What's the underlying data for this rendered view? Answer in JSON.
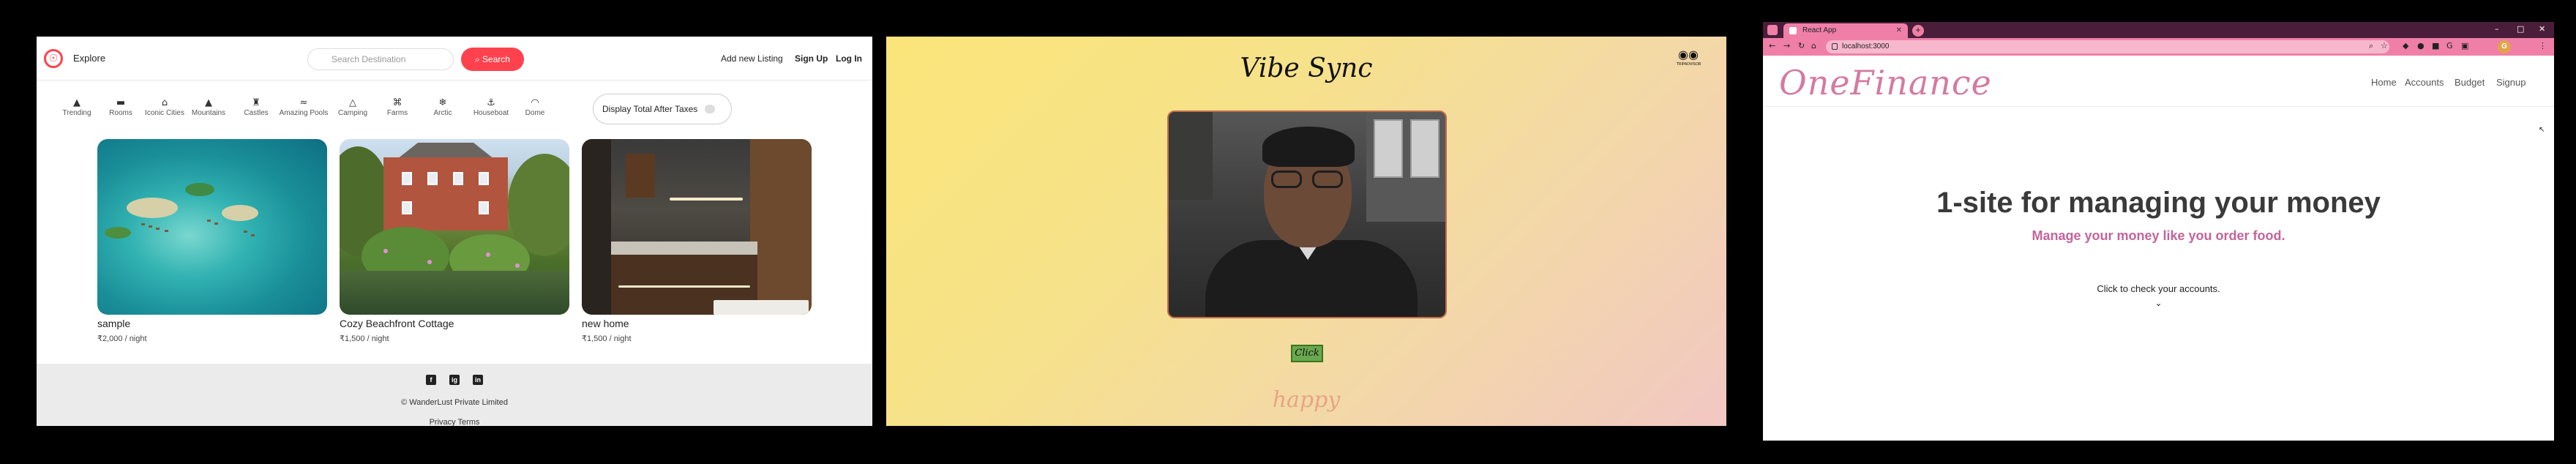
{
  "wanderlust": {
    "nav": {
      "explore": "Explore",
      "search_placeholder": "Search Destination",
      "search_button": "Search",
      "add_listing": "Add new Listing",
      "signup": "Sign Up",
      "login": "Log In"
    },
    "filters": [
      {
        "icon": "fire-icon",
        "label": "Trending"
      },
      {
        "icon": "bed-icon",
        "label": "Rooms"
      },
      {
        "icon": "city-icon",
        "label": "Iconic Cities"
      },
      {
        "icon": "mountain-icon",
        "label": "Mountains"
      },
      {
        "icon": "castle-icon",
        "label": "Castles"
      },
      {
        "icon": "pool-icon",
        "label": "Amazing Pools"
      },
      {
        "icon": "camping-icon",
        "label": "Camping"
      },
      {
        "icon": "farm-icon",
        "label": "Farms"
      },
      {
        "icon": "snowflake-icon",
        "label": "Arctic"
      },
      {
        "icon": "houseboat-icon",
        "label": "Houseboat"
      },
      {
        "icon": "dome-icon",
        "label": "Dome"
      }
    ],
    "tax_toggle": "Display Total After Taxes",
    "listings": [
      {
        "title": "sample",
        "price": "₹2,000 / night"
      },
      {
        "title": "Cozy Beachfront Cottage",
        "price": "₹1,500 / night"
      },
      {
        "title": "new home",
        "price": "₹1,500 / night"
      }
    ],
    "footer": {
      "socials": [
        "f",
        "ig",
        "in"
      ],
      "copyright": "© WanderLust Private Limited",
      "links": "Privacy Terms"
    },
    "colors": {
      "brand": "#fe424d"
    }
  },
  "vibesync": {
    "title": "Vibe Sync",
    "logo_caption": "TRIPADVISOR",
    "button": "Click",
    "mood": "happy"
  },
  "onefinance": {
    "browser": {
      "tab_title": "React App",
      "url": "localhost:3000",
      "profile_initial": "G"
    },
    "brand": "OneFinance",
    "menu": [
      "Home",
      "Accounts",
      "Budget",
      "Signup"
    ],
    "headline": "1-site for managing your money",
    "tagline": "Manage your money like you order food.",
    "cta": "Click to check your accounts.",
    "colors": {
      "brand": "#d47aa2",
      "tagline": "#c5639a",
      "chrome": "#ef7fa6"
    }
  }
}
